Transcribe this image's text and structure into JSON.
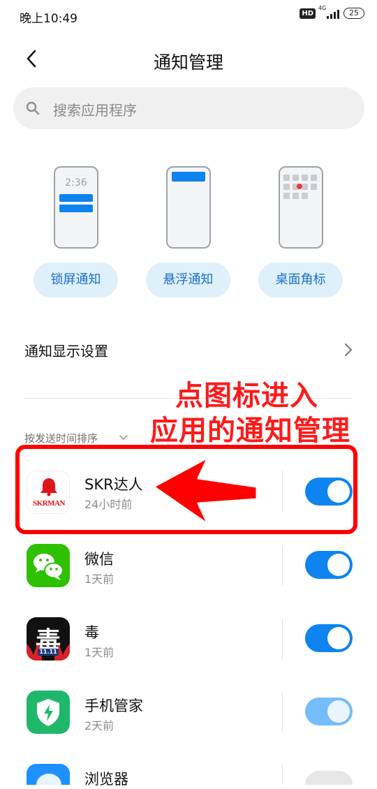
{
  "status_bar": {
    "time": "晚上10:49",
    "hd": "HD",
    "network": "4G",
    "battery": "25"
  },
  "header": {
    "title": "通知管理"
  },
  "search": {
    "placeholder": "搜索应用程序"
  },
  "notification_types": [
    {
      "label": "锁屏通知",
      "preview_time": "2:36"
    },
    {
      "label": "悬浮通知"
    },
    {
      "label": "桌面角标"
    }
  ],
  "display_settings": {
    "label": "通知显示设置"
  },
  "sort": {
    "label": "按发送时间排序"
  },
  "annotation": {
    "line1": "点图标进入",
    "line2": "应用的通知管理"
  },
  "apps": [
    {
      "name": "SKR达人",
      "time": "24小时前",
      "icon_text": "SKRMAN",
      "toggle": "on"
    },
    {
      "name": "微信",
      "time": "1天前",
      "toggle": "on"
    },
    {
      "name": "毒",
      "time": "1天前",
      "icon_text": "毒",
      "icon_sub": "11.11",
      "toggle": "on"
    },
    {
      "name": "手机管家",
      "time": "2天前",
      "toggle": "on-disabled"
    },
    {
      "name": "浏览器",
      "time": "",
      "toggle": "off"
    }
  ],
  "colors": {
    "accent": "#0d84f0",
    "accent_light": "#def0fa",
    "accent_disabled": "#74bdf8",
    "annotation": "#ff1a1a",
    "wechat": "#2dc100",
    "security": "#1fb86a"
  }
}
